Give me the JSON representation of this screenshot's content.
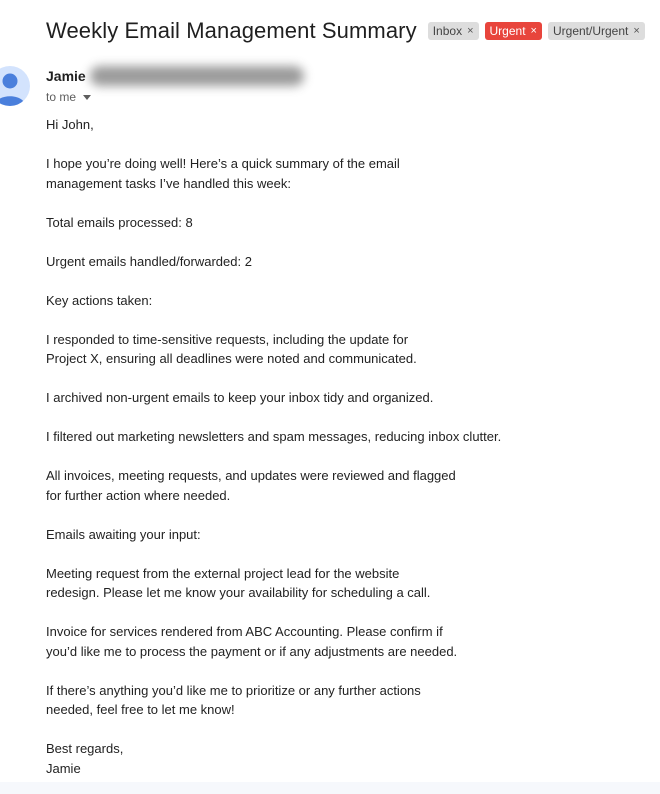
{
  "email": {
    "subject": "Weekly Email Management Summary",
    "labels": [
      {
        "text": "Inbox",
        "color": "#dddddd"
      },
      {
        "text": "Urgent",
        "color": "#e8453c"
      },
      {
        "text": "Urgent/Urgent",
        "color": "#dddddd"
      }
    ],
    "label_remove_glyph": "×",
    "sender": {
      "name": "Jamie",
      "recipient": "to me"
    },
    "body": {
      "greeting": "Hi John,",
      "intro": [
        "I hope you’re doing well! Here’s a quick summary of the email",
        "management tasks I’ve handled this week:"
      ],
      "total": "Total emails processed: 8",
      "urgent": "Urgent emails handled/forwarded: 2",
      "key_actions_heading": "Key actions taken:",
      "action_1": [
        "I responded to time-sensitive requests, including the update for",
        "Project X, ensuring all deadlines were noted and communicated."
      ],
      "action_2": "I archived non-urgent emails to keep your inbox tidy and organized.",
      "action_3": "I filtered out marketing newsletters and spam messages, reducing inbox clutter.",
      "action_4": [
        "All invoices, meeting requests, and updates were reviewed and flagged",
        "for further action where needed."
      ],
      "awaiting_heading": "Emails awaiting your input:",
      "awaiting_1": [
        "Meeting request from the external project lead for the website",
        "redesign. Please let me know your availability for scheduling a call."
      ],
      "awaiting_2": [
        "Invoice for services rendered from ABC Accounting. Please confirm if",
        "you’d like me to process the payment or if any adjustments are needed."
      ],
      "closing": [
        "If there’s anything you’d like me to prioritize or any further actions",
        "needed, feel free to let me know!"
      ],
      "signoff": "Best regards,",
      "signature": "Jamie"
    }
  }
}
